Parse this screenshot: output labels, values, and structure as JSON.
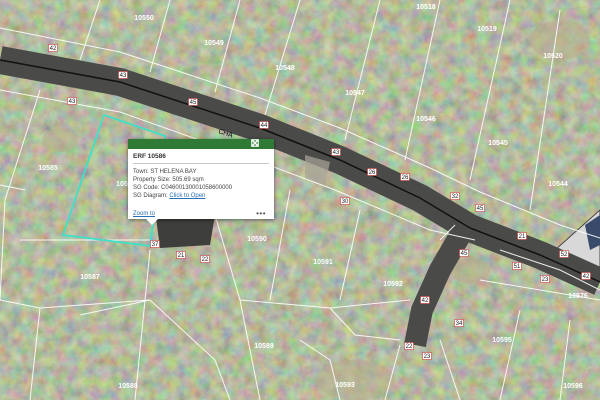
{
  "map": {
    "road_label": "CHA",
    "erfs": [
      {
        "label": "10550"
      },
      {
        "label": "10549"
      },
      {
        "label": "10548"
      },
      {
        "label": "10547"
      },
      {
        "label": "10546"
      },
      {
        "label": "10545"
      },
      {
        "label": "10544"
      },
      {
        "label": "10520"
      },
      {
        "label": "10519"
      },
      {
        "label": "10518"
      },
      {
        "label": "10585"
      },
      {
        "label": "105"
      },
      {
        "label": "10587"
      },
      {
        "label": "10590"
      },
      {
        "label": "10591"
      },
      {
        "label": "10592"
      },
      {
        "label": "10589"
      },
      {
        "label": "10588"
      },
      {
        "label": "10593"
      },
      {
        "label": "10595"
      },
      {
        "label": "10596"
      },
      {
        "label": "10576"
      }
    ],
    "segment_markers": [
      "42",
      "43",
      "45",
      "44",
      "43",
      "43",
      "26",
      "30",
      "32",
      "45",
      "21",
      "52",
      "42",
      "37",
      "21",
      "22",
      "45",
      "42",
      "22",
      "23",
      "34",
      "51",
      "23",
      "26"
    ]
  },
  "popup": {
    "title": "ERF 10586",
    "town_label": "Town:",
    "town_value": "ST HELENA BAY",
    "size_label": "Property Size:",
    "size_value": "505.69 sqm",
    "sg_code_label": "SG Code:",
    "sg_code_value": "C04600130001058600000",
    "sg_diagram_label": "SG Diagram:",
    "sg_diagram_link": "Click to Open",
    "zoom_link": "Zoom to",
    "more_label": "•••"
  },
  "colors": {
    "header": "#2f7a34",
    "highlight": "#3fe0c8",
    "road": "#4a4a48",
    "parcel_line": "#ffffff"
  }
}
